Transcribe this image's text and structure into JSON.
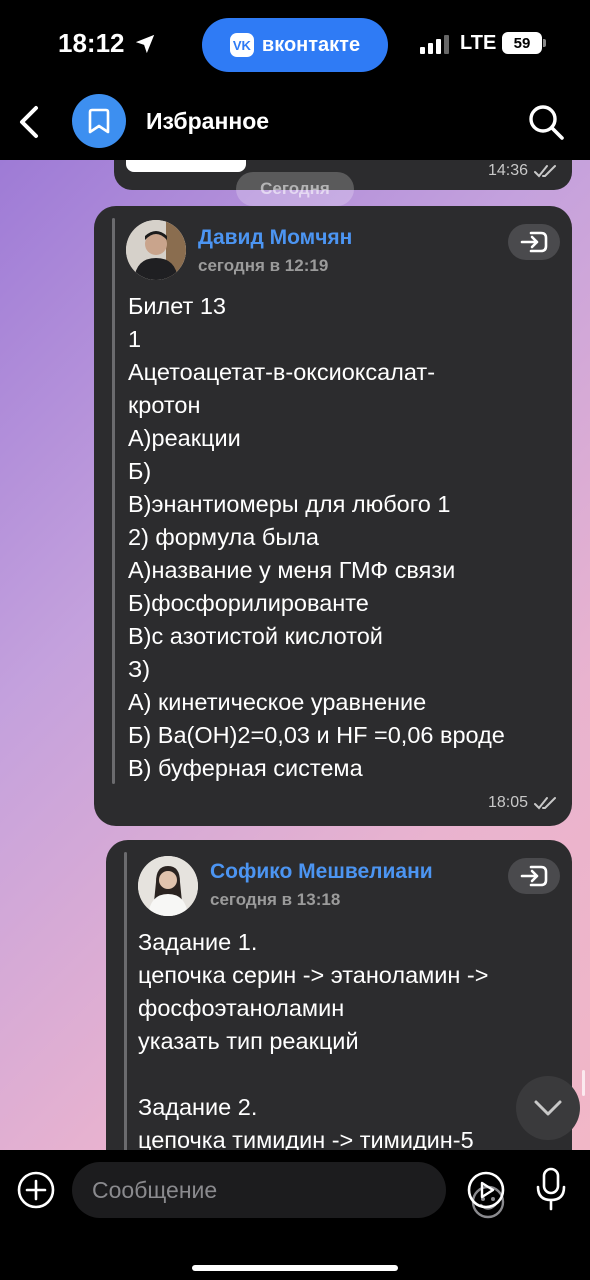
{
  "status_bar": {
    "time": "18:12",
    "app_pill": {
      "logo": "VK",
      "label": "вконтакте"
    },
    "network": "LTE",
    "battery": "59"
  },
  "header": {
    "title": "Избранное"
  },
  "chat": {
    "previous_message": {
      "time": "14:36"
    },
    "date_divider": "Сегодня",
    "messages": [
      {
        "forwarded_from": "Давид Момчян",
        "forwarded_date": "сегодня в 12:19",
        "text": "Билет 13\n1\nАцетоацетат-в-оксиоксалат-\nкротон\nА)реакции\nБ)\nВ)энантиомеры для любого 1\n2) формула была\nА)название у меня ГМФ связи\nБ)фосфорилированте\nВ)с азотистой кислотой\nЗ)\nА) кинетическое уравнение\nБ) Ba(OH)2=0,03 и HF =0,06 вроде\nВ) буферная система",
        "time": "18:05"
      },
      {
        "forwarded_from": "Софико Мешвелиани",
        "forwarded_date": "сегодня в 13:18",
        "text": "Задание 1.\nцепочка серин -> этаноламин ->\nфосфоэтаноламин\nуказать тип реакций\n\nЗадание 2.\nцепочка тимидин -> тимидин-5"
      }
    ]
  },
  "composer": {
    "placeholder": "Сообщение"
  },
  "colors": {
    "accent": "#4c95f2",
    "bubble": "#2c2c2e",
    "vk_blue": "#2f7bf5"
  },
  "icons": [
    "location-arrow-icon",
    "back-chevron-icon",
    "bookmark-icon",
    "search-icon",
    "forward-icon",
    "double-check-icon",
    "chevron-down-icon",
    "plus-icon",
    "emoji-icon",
    "video-message-icon",
    "microphone-icon"
  ]
}
